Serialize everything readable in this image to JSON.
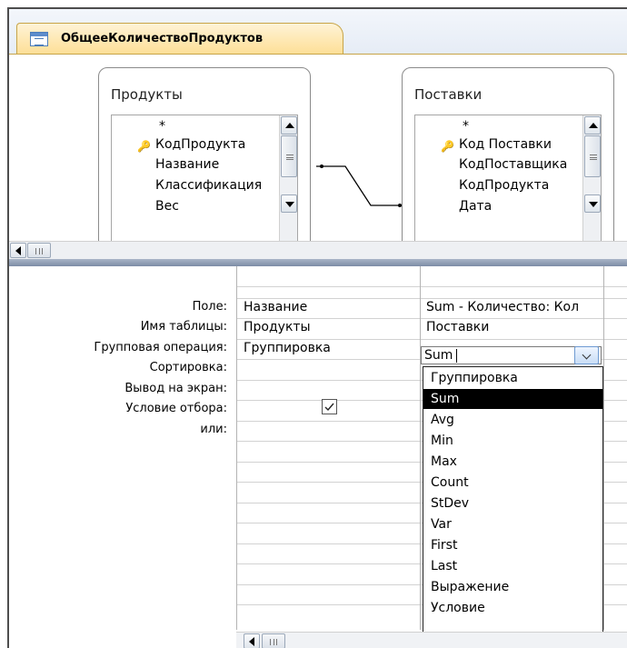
{
  "tab": {
    "title": "ОбщееКоличествоПродуктов",
    "icon": "query-table-icon"
  },
  "tables": [
    {
      "title": "Продукты",
      "fields": [
        "*",
        "КодПродукта",
        "Название",
        "Классификация",
        "Вес"
      ],
      "key_field_index": 1
    },
    {
      "title": "Поставки",
      "fields": [
        "*",
        "Код Поставки",
        "КодПоставщика",
        "КодПродукта",
        "Дата"
      ],
      "key_field_index": 1
    }
  ],
  "grid": {
    "row_labels": {
      "field": "Поле:",
      "table": "Имя таблицы:",
      "group": "Групповая операция:",
      "sort": "Сортировка:",
      "show": "Вывод на экран:",
      "criteria": "Условие отбора:",
      "or": "или:"
    },
    "col1": {
      "field": "Название",
      "table": "Продукты",
      "group": "Группировка",
      "show": true
    },
    "col2": {
      "field": "Sum - Количество: Кол",
      "table": "Поставки",
      "group": "Sum"
    }
  },
  "dropdown": {
    "options": [
      "Группировка",
      "Sum",
      "Avg",
      "Min",
      "Max",
      "Count",
      "StDev",
      "Var",
      "First",
      "Last",
      "Выражение",
      "Условие"
    ],
    "selected_index": 1
  },
  "colors": {
    "tab_bg": "#fddf97",
    "splitter": "#7d8da6",
    "selection": "#000000"
  }
}
